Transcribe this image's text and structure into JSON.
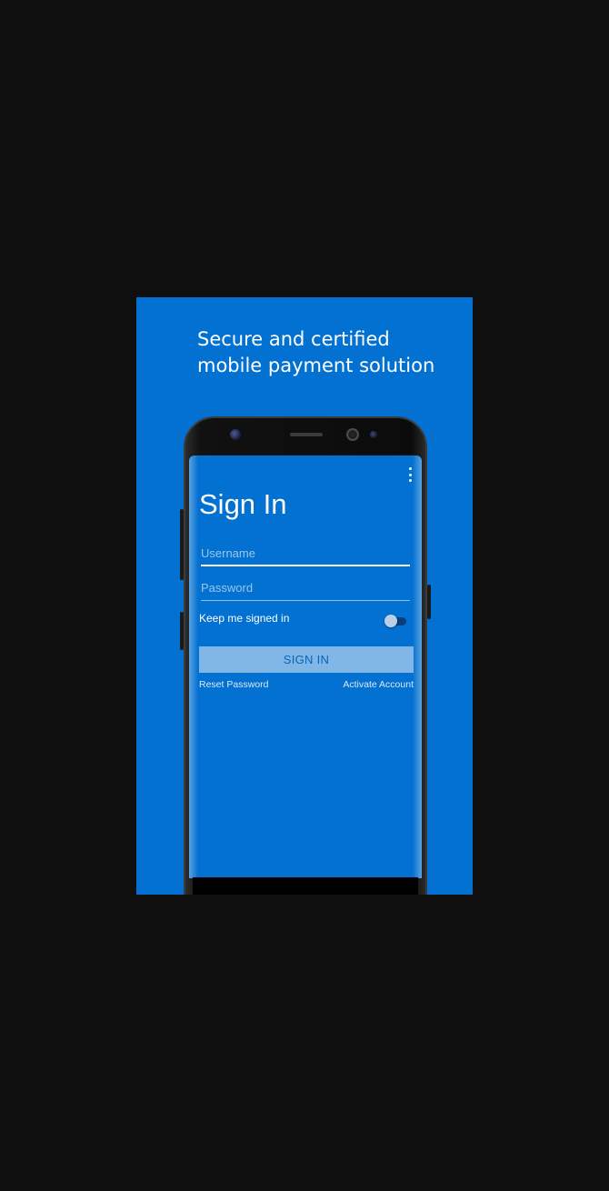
{
  "banner": {
    "headline_line1": "Secure and certified",
    "headline_line2": "mobile payment solution",
    "background_color": "#0271d1"
  },
  "phone": {
    "menu_icon": "more-vertical-icon",
    "signin_title": "Sign In",
    "username": {
      "placeholder": "Username",
      "value": ""
    },
    "password": {
      "placeholder": "Password",
      "value": ""
    },
    "keep_signed_in": {
      "label": "Keep me signed in",
      "checked": false
    },
    "signin_button_label": "SIGN IN",
    "reset_password_link": "Reset Password",
    "activate_account_link": "Activate Account"
  }
}
